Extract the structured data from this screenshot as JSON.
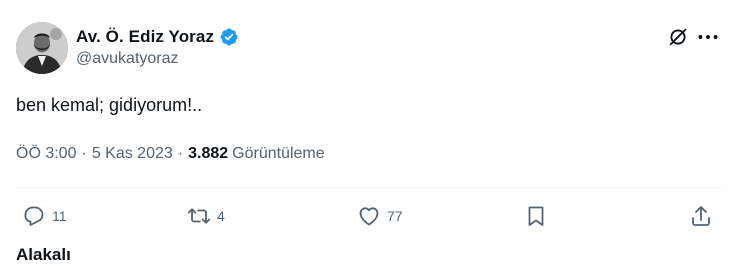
{
  "user": {
    "display_name": "Av. Ö. Ediz Yoraz",
    "handle": "@avukatyoraz",
    "verified": true
  },
  "tweet": {
    "text": "ben kemal; gidiyorum!..",
    "time": "ÖÖ 3:00",
    "date": "5 Kas 2023",
    "separator": "·",
    "views_count": "3.882",
    "views_label": "Görüntüleme"
  },
  "actions": {
    "reply_count": "11",
    "repost_count": "4",
    "like_count": "77"
  },
  "related_label": "Alakalı",
  "colors": {
    "verified": "#1d9bf0",
    "text_primary": "#0f1419",
    "text_secondary": "#536471",
    "divider": "#eff3f4"
  },
  "icons": {
    "verified": "verified-badge-icon",
    "grok": "grok-icon",
    "more": "more-horizontal-icon",
    "reply": "reply-icon",
    "repost": "repost-icon",
    "like": "like-icon",
    "bookmark": "bookmark-icon",
    "share": "share-icon"
  }
}
